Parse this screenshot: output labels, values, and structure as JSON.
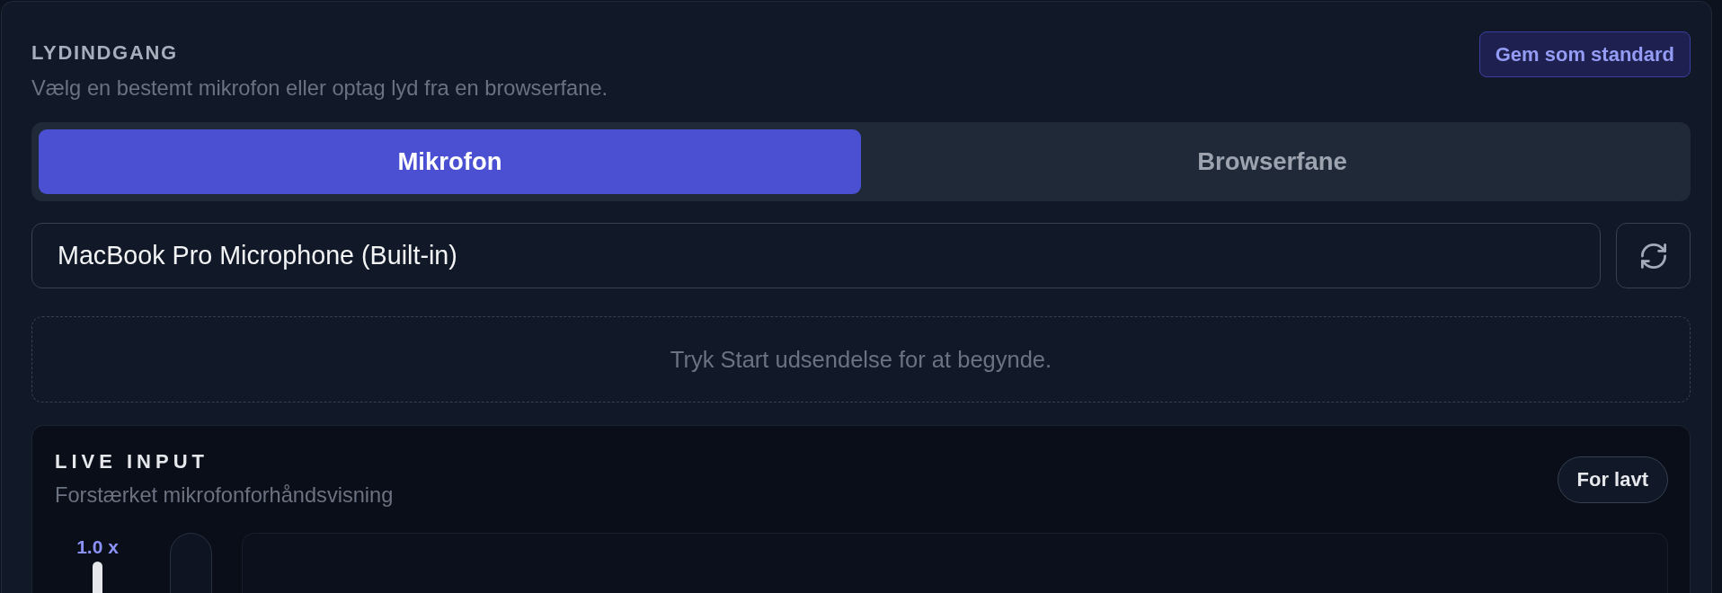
{
  "panel": {
    "title": "LYDINDGANG",
    "description": "Vælg en bestemt mikrofon eller optag lyd fra en browserfane.",
    "save_button": "Gem som standard"
  },
  "source_tabs": [
    {
      "label": "Mikrofon",
      "selected": true
    },
    {
      "label": "Browserfane",
      "selected": false
    }
  ],
  "device_select": {
    "value": "MacBook Pro Microphone (Built-in)"
  },
  "status_message": "Tryk Start udsendelse for at begynde.",
  "live_input": {
    "title": "LIVE INPUT",
    "subtitle": "Forstærket mikrofonforhåndsvisning",
    "status_badge": "For lavt",
    "gain_reading": "1.0 x"
  }
}
